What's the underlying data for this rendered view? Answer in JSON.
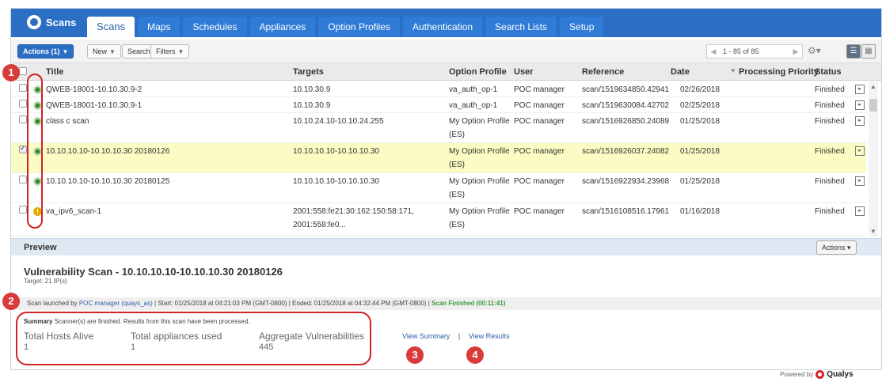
{
  "brand": {
    "name": "Scans"
  },
  "nav": {
    "tabs": [
      {
        "label": "Scans",
        "active": true
      },
      {
        "label": "Maps"
      },
      {
        "label": "Schedules"
      },
      {
        "label": "Appliances"
      },
      {
        "label": "Option Profiles"
      },
      {
        "label": "Authentication"
      },
      {
        "label": "Search Lists"
      },
      {
        "label": "Setup"
      }
    ]
  },
  "toolbar": {
    "actions_label": "Actions (1)",
    "new_label": "New",
    "search_label": "Search",
    "filters_label": "Filters",
    "pager_range": "1 - 85 of 85"
  },
  "columns": {
    "title": "Title",
    "targets": "Targets",
    "option_profile": "Option Profile",
    "user": "User",
    "reference": "Reference",
    "date": "Date",
    "processing_priority": "Processing Priority",
    "status": "Status"
  },
  "rows": [
    {
      "status_icon": "ok",
      "title": "QWEB-18001-10.10.30.9-2",
      "targets": "10.10.30.9",
      "targets2": "",
      "option_profile": "va_auth_op-1",
      "option_profile2": "",
      "user": "POC manager",
      "reference": "scan/1519634850.42941",
      "date": "02/26/2018",
      "status": "Finished",
      "checked": false,
      "selected": false
    },
    {
      "status_icon": "ok",
      "title": "QWEB-18001-10.10.30.9-1",
      "targets": "10.10.30.9",
      "targets2": "",
      "option_profile": "va_auth_op-1",
      "option_profile2": "",
      "user": "POC manager",
      "reference": "scan/1519630084.42702",
      "date": "02/25/2018",
      "status": "Finished",
      "checked": false,
      "selected": false
    },
    {
      "status_icon": "ok",
      "title": "class c scan",
      "targets": "10.10.24.10-10.10.24.255",
      "targets2": "",
      "option_profile": "My Option Profile",
      "option_profile2": "(ES)",
      "user": "POC manager",
      "reference": "scan/1516926850.24089",
      "date": "01/25/2018",
      "status": "Finished",
      "checked": false,
      "selected": false
    },
    {
      "status_icon": "ok",
      "title": "10.10.10.10-10.10.10.30 20180126",
      "targets": "10.10.10.10-10.10.10.30",
      "targets2": "",
      "option_profile": "My Option Profile",
      "option_profile2": "(ES)",
      "user": "POC manager",
      "reference": "scan/1516926037.24082",
      "date": "01/25/2018",
      "status": "Finished",
      "checked": true,
      "selected": true
    },
    {
      "status_icon": "ok",
      "title": "10.10.10.10-10.10.10.30 20180125",
      "targets": "10.10.10.10-10.10.10.30",
      "targets2": "",
      "option_profile": "My Option Profile",
      "option_profile2": "(ES)",
      "user": "POC manager",
      "reference": "scan/1516922934.23968",
      "date": "01/25/2018",
      "status": "Finished",
      "checked": false,
      "selected": false
    },
    {
      "status_icon": "warn",
      "title": "va_ipv6_scan-1",
      "targets": "2001:558:fe21:30:162:150:58:171,",
      "targets2": "2001:558:fe0...",
      "option_profile": "My Option Profile",
      "option_profile2": "(ES)",
      "user": "POC manager",
      "reference": "scan/1516108516.17961",
      "date": "01/16/2018",
      "status": "Finished",
      "checked": false,
      "selected": false
    }
  ],
  "preview": {
    "label": "Preview",
    "actions_label": "Actions",
    "scan_title": "Vulnerability Scan - 10.10.10.10-10.10.10.30 20180126",
    "target_count": "Target: 21 IP(s)",
    "launch_prefix": "Scan launched by",
    "launch_user": "POC manager (quays_as)",
    "launch_times": "| Start: 01/25/2018 at 04:21:03 PM (GMT-0800) | Ended: 01/25/2018 at 04:32:44 PM (GMT-0800) |",
    "launch_status": "Scan Finished (00:11:41)",
    "summary_label": "Summary",
    "summary_text": "Scanner(s) are finished. Results from this scan have been processed.",
    "stats": [
      {
        "label": "Total Hosts Alive",
        "value": "1"
      },
      {
        "label": "Total appliances used",
        "value": "1"
      },
      {
        "label": "Aggregate Vulnerabilities",
        "value": "445"
      }
    ],
    "view_summary": "View Summary",
    "link_separator": "|",
    "view_results": "View Results"
  },
  "annotations": [
    "1",
    "2",
    "3",
    "4"
  ],
  "footer": {
    "powered_by": "Powered by",
    "vendor": "Qualys"
  }
}
